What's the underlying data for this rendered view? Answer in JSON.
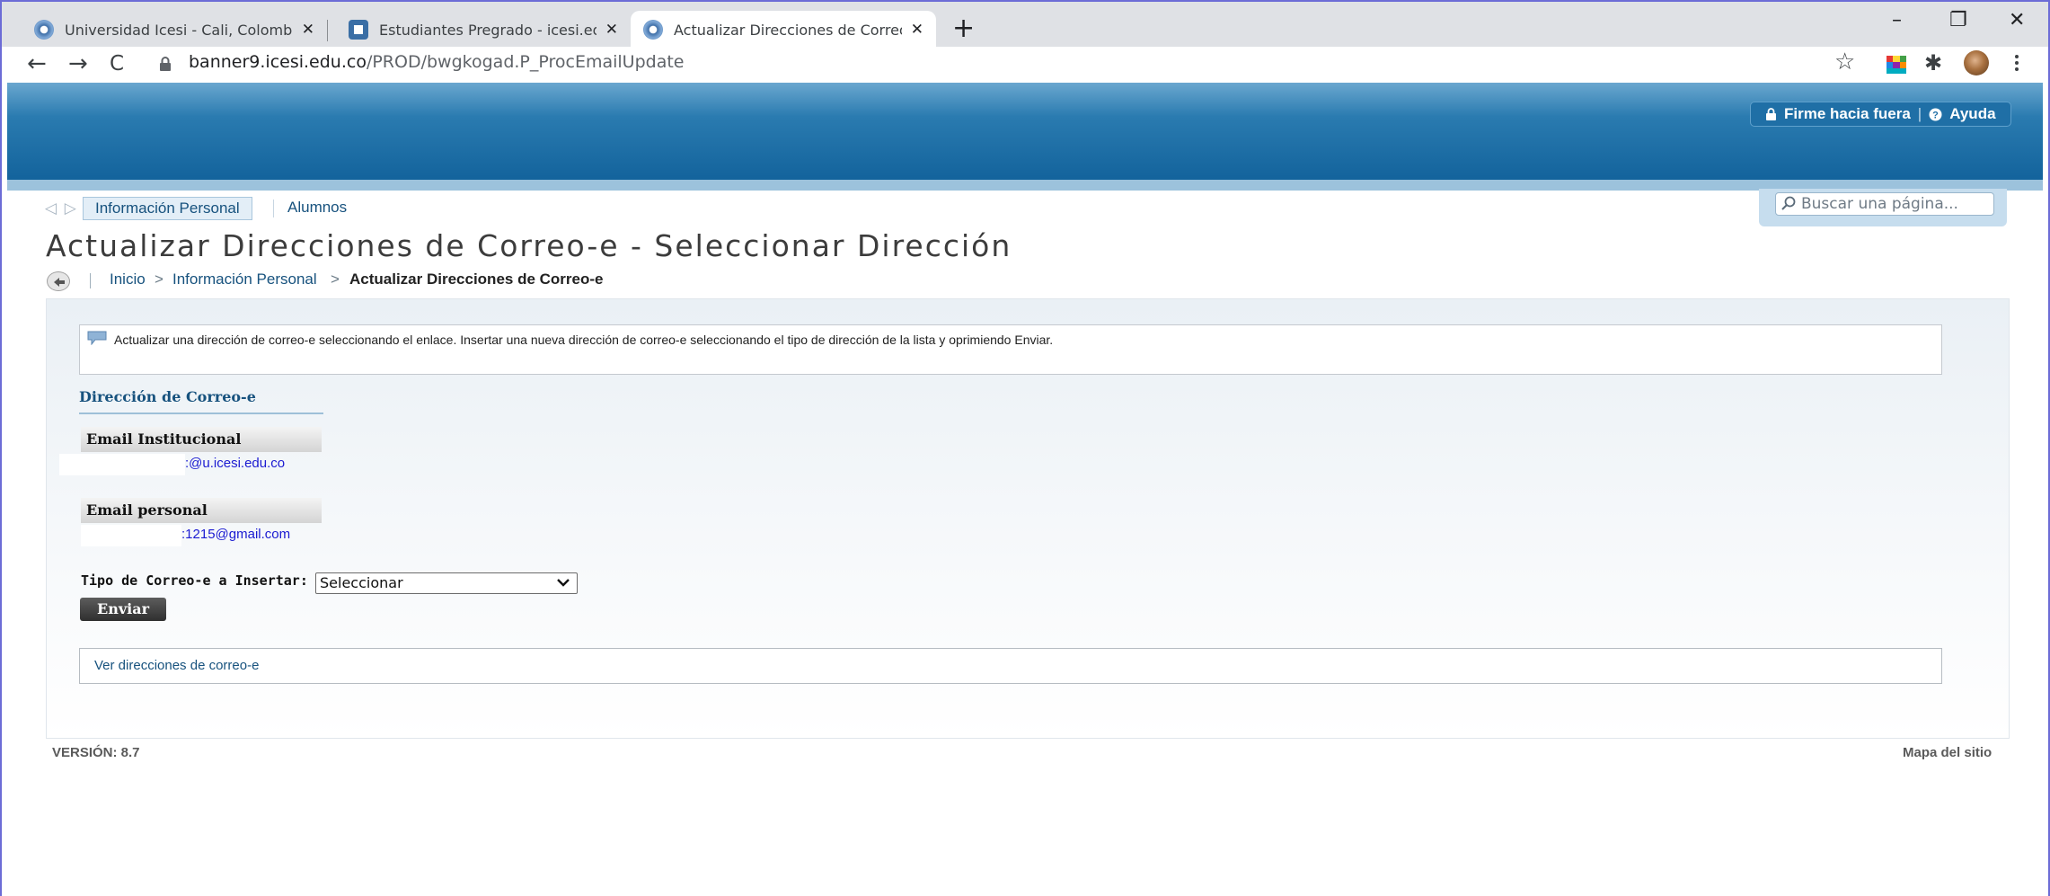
{
  "browser": {
    "tabs": [
      {
        "title": "Universidad Icesi - Cali, Colombia",
        "active": false
      },
      {
        "title": "Estudiantes Pregrado - icesi.edu.co",
        "active": false
      },
      {
        "title": "Actualizar Direcciones de Correo-e",
        "active": true
      }
    ],
    "new_tab": "+",
    "window_controls": {
      "minimize": "–",
      "restore": "❐",
      "close": "✕"
    },
    "nav": {
      "back": "←",
      "forward": "→",
      "reload": "C"
    },
    "url_host": "banner9.icesi.edu.co",
    "url_path": "/PROD/bwgkogad.P_ProcEmailUpdate",
    "toolbar_icons": {
      "bookmark": "☆",
      "extensions": "✱"
    }
  },
  "header": {
    "signout_label": "Firme hacia fuera",
    "separator": "|",
    "help_label": "Ayuda"
  },
  "menu": {
    "nav_arrows": "◁ ▷",
    "tabs": [
      "Información Personal",
      "Alumnos"
    ],
    "search_placeholder": "Buscar una página..."
  },
  "page": {
    "title": "Actualizar Direcciones de Correo-e - Seleccionar Dirección",
    "breadcrumb": {
      "home": "Inicio",
      "section": "Información Personal",
      "current": "Actualizar Direcciones de Correo-e",
      "separator": ">"
    },
    "info_text": "Actualizar una dirección de correo-e seleccionando el enlace. Insertar una nueva dirección de correo-e seleccionando el tipo de dirección de la lista y oprimiendo Enviar.",
    "section_heading": "Dirección de Correo-e",
    "emails": [
      {
        "type": "Email Institucional",
        "address": ":@u.icesi.edu.co"
      },
      {
        "type": "Email personal",
        "address": ":1215@gmail.com"
      }
    ],
    "insert_label": "Tipo de Correo-e a Insertar:",
    "insert_select_value": "Seleccionar",
    "submit_label": "Enviar",
    "view_link": "Ver direcciones de correo-e"
  },
  "footer": {
    "version": "VERSIÓN: 8.7",
    "sitemap": "Mapa del sitio"
  },
  "colors": {
    "banner_dark": "#13639c",
    "banner_light": "#6aa7cf",
    "link": "#17527e",
    "email_link": "#1b1bd1"
  }
}
